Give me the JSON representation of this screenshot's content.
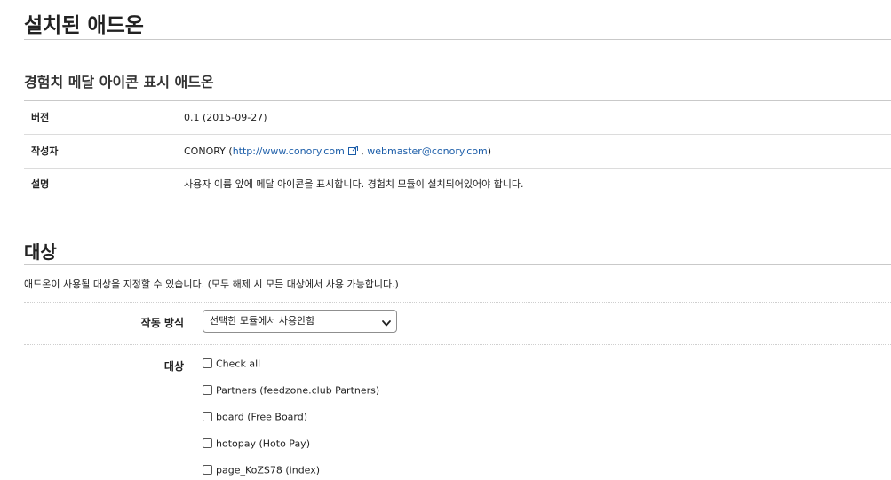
{
  "page": {
    "title": "설치된 애드온"
  },
  "addon": {
    "name": "경험치 메달 아이콘 표시 애드온",
    "rows": [
      {
        "label": "버전",
        "value": "0.1 (2015-09-27)"
      },
      {
        "label": "작성자"
      },
      {
        "label": "설명",
        "value": "사용자 이름 앞에 메달 아이콘을 표시합니다. 경험치 모듈이 설치되어있어야 합니다."
      }
    ],
    "author": {
      "name": "CONORY",
      "open_paren": "(",
      "site": "http://www.conory.com",
      "separator": " , ",
      "email": "webmaster@conory.com",
      "close_paren": ")"
    }
  },
  "target": {
    "heading": "대상",
    "description": "애드온이 사용될 대상을 지정할 수 있습니다. (모두 해제 시 모든 대상에서 사용 가능합니다.)",
    "mode_label": "작동 방식",
    "mode_value": "선택한 모듈에서 사용안함",
    "target_label": "대상",
    "checkboxes": [
      "Check all",
      "Partners (feedzone.club Partners)",
      "board (Free Board)",
      "hotopay (Hoto Pay)",
      "page_KoZS78 (index)"
    ]
  },
  "icons": {
    "external_link": "external-link-icon",
    "dropdown": "chevron-down-icon"
  },
  "colors": {
    "link": "#1a5ca8",
    "text": "#222222",
    "rule": "#c9c9c9"
  }
}
